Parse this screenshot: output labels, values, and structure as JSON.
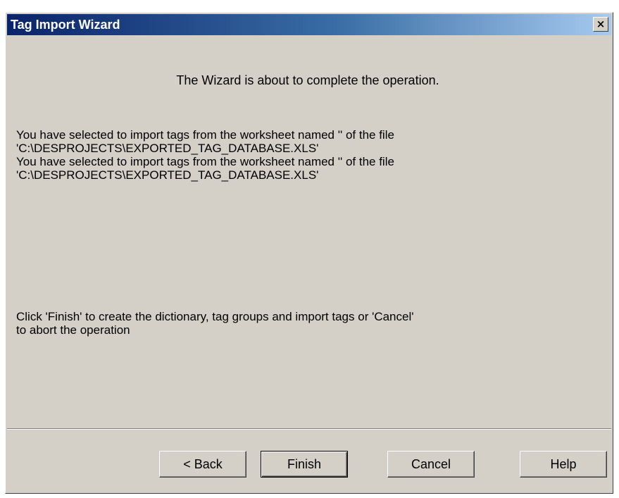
{
  "window": {
    "title": "Tag Import Wizard",
    "close_glyph": "×"
  },
  "content": {
    "headline": "The Wizard is about to complete the operation.",
    "selection_lines": [
      "You have selected to import tags from the worksheet named '' of the file",
      "'C:\\DESPROJECTS\\EXPORTED_TAG_DATABASE.XLS'",
      "You have selected to import tags from the worksheet named '' of the file",
      "'C:\\DESPROJECTS\\EXPORTED_TAG_DATABASE.XLS'"
    ],
    "instruction_lines": [
      "Click 'Finish' to create the dictionary, tag groups and import tags or 'Cancel'",
      "to  abort the operation"
    ]
  },
  "buttons": {
    "back": "< Back",
    "finish": "Finish",
    "cancel": "Cancel",
    "help": "Help"
  }
}
